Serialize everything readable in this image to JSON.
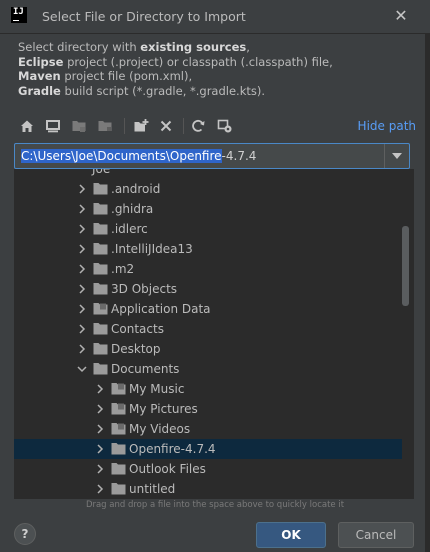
{
  "window": {
    "title": "Select File or Directory to Import",
    "close_glyph": "✕"
  },
  "description": {
    "line1_prefix": "Select directory with ",
    "line1_bold": "existing sources",
    "line1_suffix": ",",
    "line2_bold": "Eclipse",
    "line2_rest": " project (.project) or classpath (.classpath) file,",
    "line3_bold": "Maven",
    "line3_rest": " project file (pom.xml),",
    "line4_bold": "Gradle",
    "line4_rest": " build script (*.gradle, *.gradle.kts)."
  },
  "toolbar": {
    "icons": [
      "home-icon",
      "desktop-icon",
      "project-folder-icon",
      "module-folder-icon",
      "new-folder-icon",
      "delete-icon",
      "refresh-icon",
      "show-hidden-icon"
    ],
    "hide_path_label": "Hide path"
  },
  "path": {
    "selected_part": "C:\\Users\\Joe\\Documents\\Openfire",
    "rest_part": "-4.7.4"
  },
  "tree": {
    "top_partial": "Joe",
    "rows": [
      {
        "label": ".android",
        "level": 1,
        "expanded": false,
        "special": false
      },
      {
        "label": ".ghidra",
        "level": 1,
        "expanded": false,
        "special": false
      },
      {
        "label": ".idlerc",
        "level": 1,
        "expanded": false,
        "special": false
      },
      {
        "label": ".IntelliJIdea13",
        "level": 1,
        "expanded": false,
        "special": false
      },
      {
        "label": ".m2",
        "level": 1,
        "expanded": false,
        "special": false
      },
      {
        "label": "3D Objects",
        "level": 1,
        "expanded": false,
        "special": false
      },
      {
        "label": "Application Data",
        "level": 1,
        "expanded": false,
        "special": true
      },
      {
        "label": "Contacts",
        "level": 1,
        "expanded": false,
        "special": false
      },
      {
        "label": "Desktop",
        "level": 1,
        "expanded": false,
        "special": false
      },
      {
        "label": "Documents",
        "level": 1,
        "expanded": true,
        "special": false
      },
      {
        "label": "My Music",
        "level": 2,
        "expanded": false,
        "special": true
      },
      {
        "label": "My Pictures",
        "level": 2,
        "expanded": false,
        "special": true
      },
      {
        "label": "My Videos",
        "level": 2,
        "expanded": false,
        "special": true
      },
      {
        "label": "Openfire-4.7.4",
        "level": 2,
        "expanded": false,
        "special": false,
        "selected": true
      },
      {
        "label": "Outlook Files",
        "level": 2,
        "expanded": false,
        "special": false
      },
      {
        "label": "untitled",
        "level": 2,
        "expanded": false,
        "special": false
      }
    ]
  },
  "hint": "Drag and drop a file into the space above to quickly locate it",
  "buttons": {
    "help": "?",
    "ok": "OK",
    "cancel": "Cancel"
  }
}
